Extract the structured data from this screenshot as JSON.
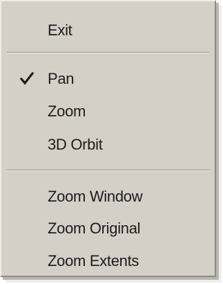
{
  "menu": {
    "groups": [
      {
        "items": [
          {
            "label": "Exit",
            "checked": false
          }
        ]
      },
      {
        "items": [
          {
            "label": "Pan",
            "checked": true
          },
          {
            "label": "Zoom",
            "checked": false
          },
          {
            "label": "3D Orbit",
            "checked": false
          }
        ]
      },
      {
        "items": [
          {
            "label": "Zoom Window",
            "checked": false
          },
          {
            "label": "Zoom Original",
            "checked": false
          },
          {
            "label": "Zoom Extents",
            "checked": false
          }
        ]
      }
    ],
    "checkmark_icon": "checkmark-icon",
    "colors": {
      "background": "#d4d0c8",
      "text": "#1c1c1c"
    }
  }
}
